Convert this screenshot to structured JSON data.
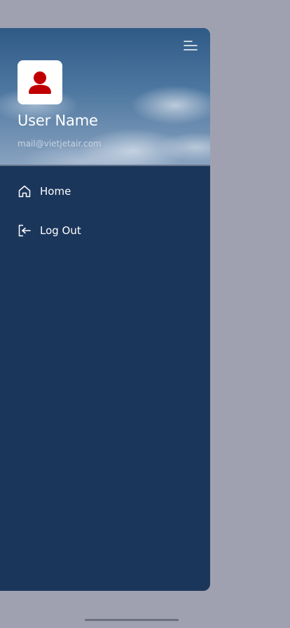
{
  "drawer": {
    "user_name": "User Name",
    "user_email": "mail@vietjetair.com",
    "menu_icon": "menu-lines-icon",
    "avatar_icon": "user-icon",
    "nav_items": [
      {
        "label": "Home",
        "icon": "home-icon"
      },
      {
        "label": "Log Out",
        "icon": "logout-icon"
      }
    ]
  },
  "colors": {
    "drawer_background": "#1b365b",
    "avatar_accent": "#c00000",
    "overlay": "#9fa1b1",
    "text": "#ffffff"
  }
}
